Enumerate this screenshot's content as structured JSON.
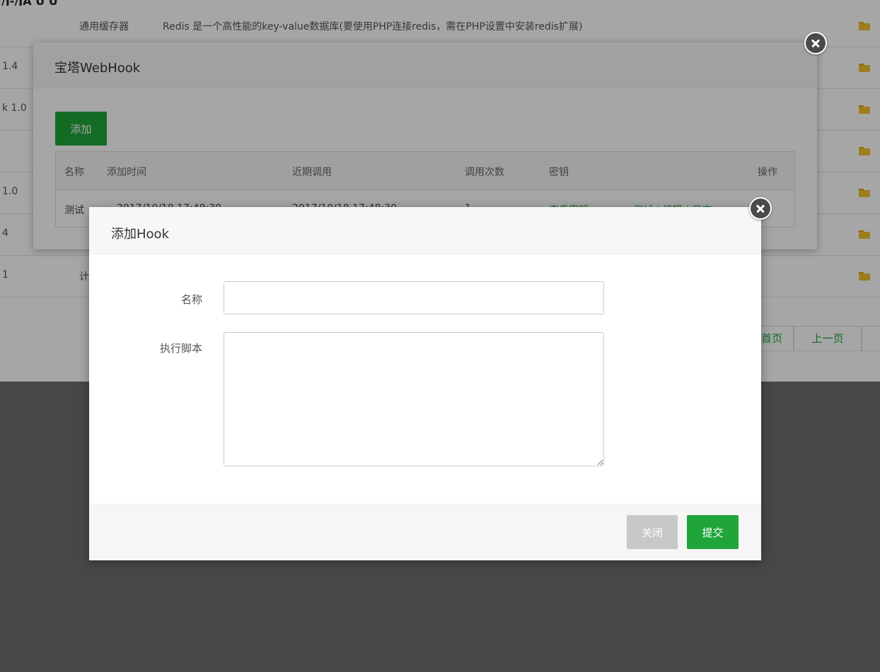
{
  "background": {
    "top_cut_text": "/J-/JA   U U",
    "rows": [
      {
        "version": "",
        "name": "通用缓存器",
        "description": "Redis 是一个高性能的key-value数据库(要使用PHP连接redis，需在PHP设置中安装redis扩展)"
      },
      {
        "version": "1.4",
        "name": "",
        "description": ""
      },
      {
        "version": "k 1.0",
        "name": "",
        "description": ""
      },
      {
        "version": "",
        "name": "",
        "description": ""
      },
      {
        "version": "1.0",
        "name": "",
        "description": ""
      },
      {
        "version": "4",
        "name": "",
        "description": ""
      },
      {
        "version": "1",
        "name": "计",
        "description": ""
      }
    ],
    "pager": {
      "first_label": "首页",
      "prev_label": "上一页"
    }
  },
  "webhook_dialog": {
    "title": "宝塔WebHook",
    "add_label": "添加",
    "columns": [
      "名称",
      "添加时间",
      "近期调用",
      "调用次数",
      "密钥",
      "操作"
    ],
    "rows": [
      {
        "name": "测试",
        "added": "2017/10/18 17:48:30",
        "recent": "2017/10/18 17:48:30",
        "count": "1",
        "key": "查看密钥",
        "actions": "测试 | 编辑 | 日志"
      }
    ]
  },
  "add_hook_dialog": {
    "title": "添加Hook",
    "name_label": "名称",
    "name_value": "",
    "script_label": "执行脚本",
    "script_value": "",
    "close_label": "关闭",
    "submit_label": "提交"
  },
  "colors": {
    "accent_green": "#20a53a",
    "disabled_gray": "#c8c8c8",
    "overlay_dark": "#4a4a4a"
  }
}
